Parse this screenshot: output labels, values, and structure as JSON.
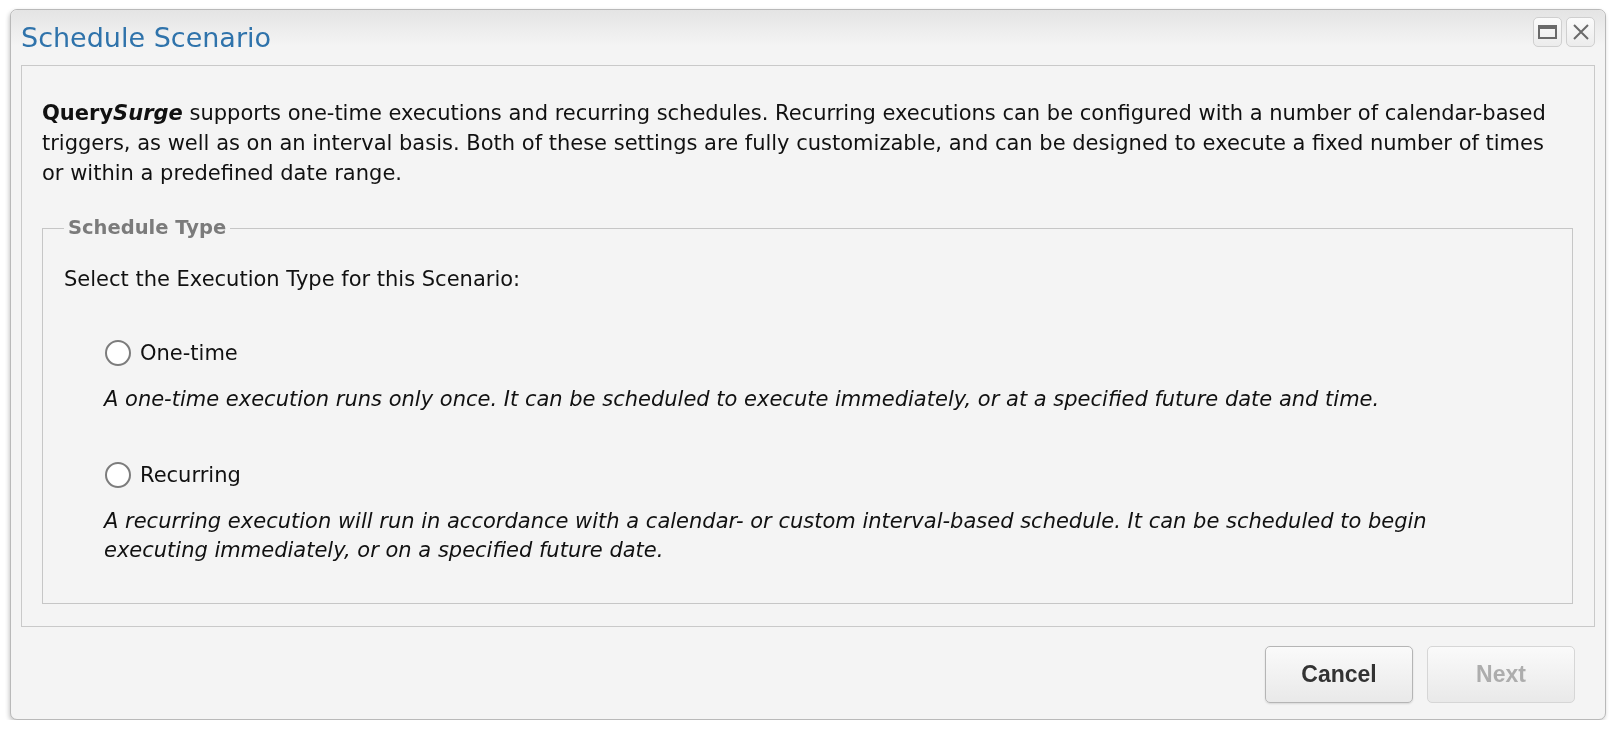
{
  "window": {
    "title": "Schedule Scenario"
  },
  "intro": {
    "brand_lead": "Query",
    "brand_accent": "Surge",
    "body": " supports one-time executions and recurring schedules. Recurring executions can be configured with a number of calendar-based triggers, as well as on an interval basis. Both of these settings are fully customizable, and can be designed to execute a fixed number of times or within a predefined date range."
  },
  "schedule_type": {
    "legend": "Schedule Type",
    "prompt": "Select the Execution Type for this Scenario:",
    "options": [
      {
        "label": "One-time",
        "selected": false,
        "description": "A one-time execution runs only once. It can be scheduled to execute immediately, or at a specified future date and time."
      },
      {
        "label": "Recurring",
        "selected": false,
        "description": "A recurring execution will run in accordance with a calendar- or custom interval-based schedule. It can be scheduled to begin executing immediately, or on a specified future date."
      }
    ]
  },
  "buttons": [
    {
      "label": "Cancel",
      "disabled": false
    },
    {
      "label": "Next",
      "disabled": true
    }
  ]
}
